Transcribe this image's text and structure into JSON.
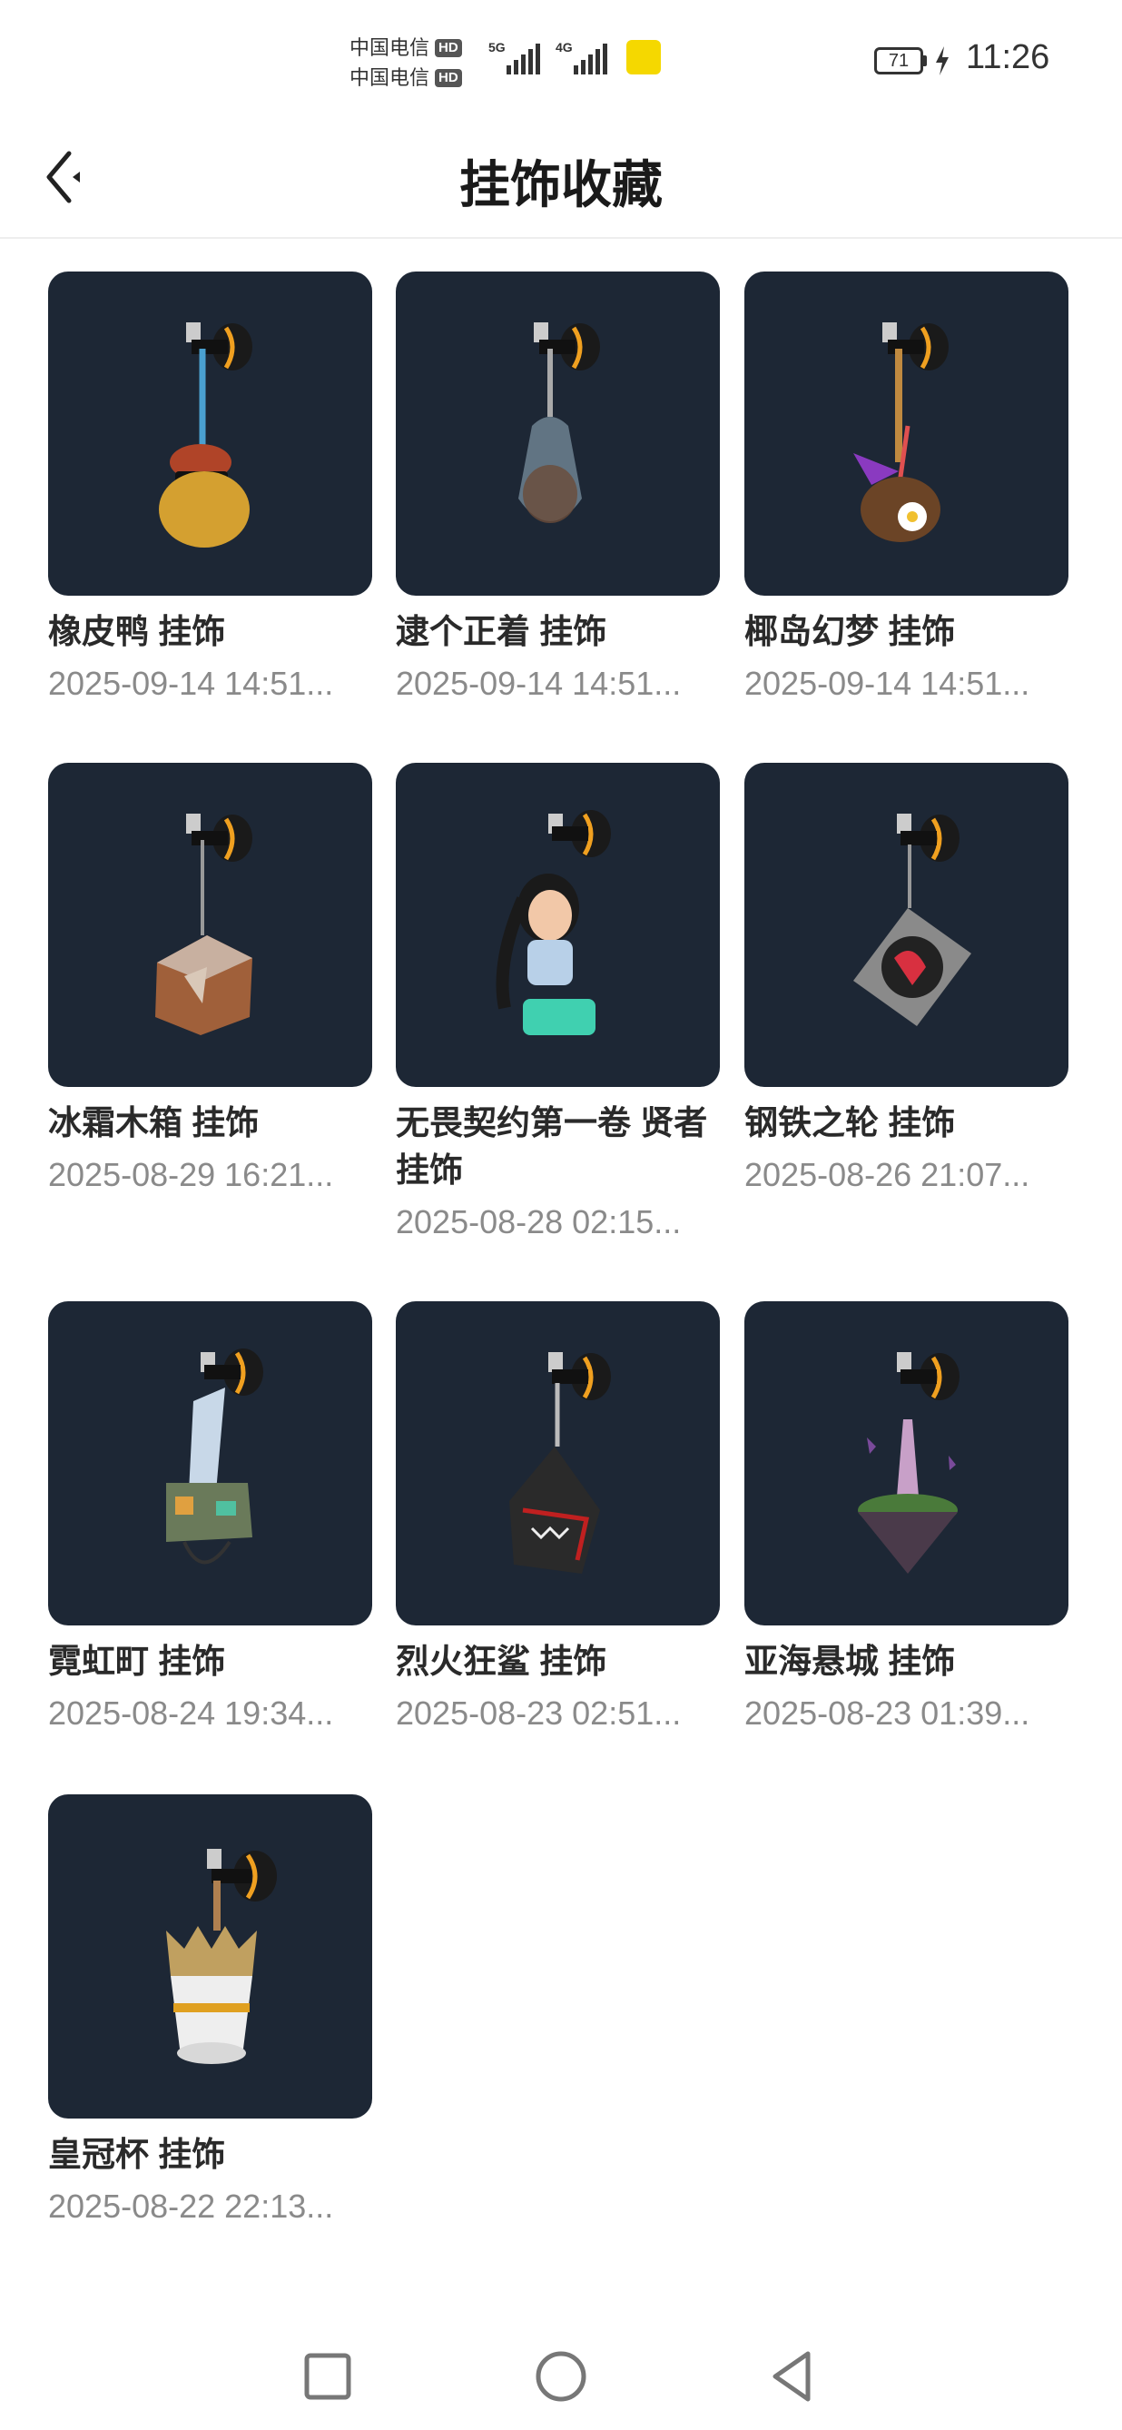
{
  "status_bar": {
    "carrier_1": "中国电信",
    "carrier_2": "中国电信",
    "hd_1": "HD",
    "hd_2": "HD",
    "network_1": "5G",
    "network_2": "4G",
    "battery": "71",
    "time": "11:26"
  },
  "header": {
    "title": "挂饰收藏"
  },
  "items": [
    {
      "name": "橡皮鸭 挂饰",
      "date": "2025-09-14 14:51...",
      "icon": "rubber-duck-charm"
    },
    {
      "name": "逮个正着 挂饰",
      "date": "2025-09-14 14:51...",
      "icon": "caught-jar-charm"
    },
    {
      "name": "椰岛幻梦 挂饰",
      "date": "2025-09-14 14:51...",
      "icon": "coconut-charm"
    },
    {
      "name": "冰霜木箱 挂饰",
      "date": "2025-08-29 16:21...",
      "icon": "wooden-crate-charm"
    },
    {
      "name": "无畏契约第一卷 贤者 挂饰",
      "date": "2025-08-28 02:15...",
      "icon": "sage-figure-charm"
    },
    {
      "name": "钢铁之轮 挂饰",
      "date": "2025-08-26 21:07...",
      "icon": "turntable-charm"
    },
    {
      "name": "霓虹町 挂饰",
      "date": "2025-08-24 19:34...",
      "icon": "neon-city-charm"
    },
    {
      "name": "烈火狂鲨 挂饰",
      "date": "2025-08-23 02:51...",
      "icon": "shark-charm"
    },
    {
      "name": "亚海悬城 挂饰",
      "date": "2025-08-23 01:39...",
      "icon": "floating-island-charm"
    },
    {
      "name": "皇冠杯 挂饰",
      "date": "2025-08-22 22:13...",
      "icon": "crown-cup-charm"
    }
  ],
  "nav_bar": {
    "recent_icon": "square-icon",
    "home_icon": "circle-icon",
    "back_icon": "triangle-back-icon"
  },
  "colors": {
    "thumb_bg": "#1d2735",
    "accent_orange": "#f0a020"
  }
}
